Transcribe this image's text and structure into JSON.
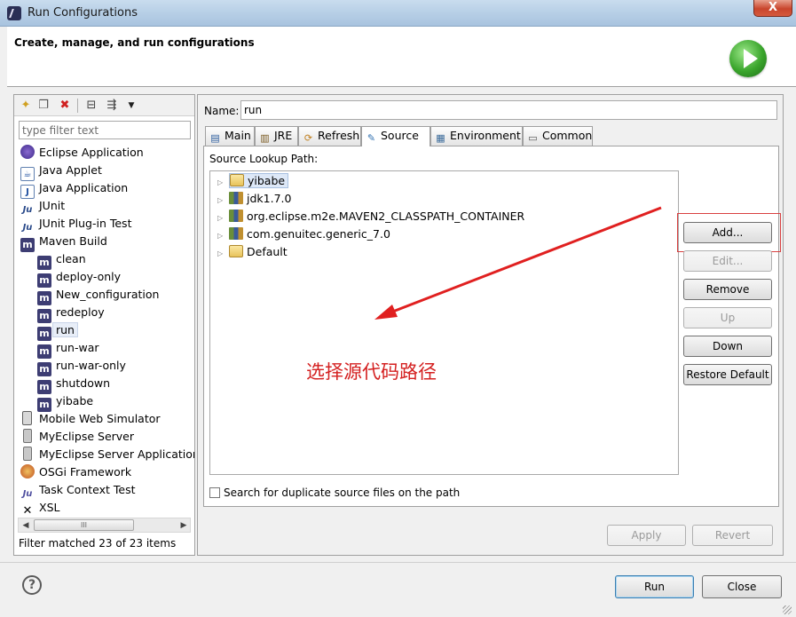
{
  "window": {
    "title": "Run Configurations",
    "close_glyph": "X"
  },
  "banner": {
    "title": "Create, manage, and run configurations",
    "icon": "run-icon"
  },
  "left": {
    "toolbar": {
      "new_icon": "new-config-icon",
      "duplicate_icon": "duplicate-icon",
      "delete_icon": "delete-icon",
      "collapse_icon": "collapse-all-icon",
      "filter_icon": "filter-icon"
    },
    "filter_placeholder": "type filter text",
    "tree": [
      {
        "label": "Eclipse Application",
        "icon": "eclipse-icon",
        "glyph": ""
      },
      {
        "label": "Java Applet",
        "icon": "java-applet-icon",
        "glyph": "☕"
      },
      {
        "label": "Java Application",
        "icon": "java-app-icon",
        "glyph": "J"
      },
      {
        "label": "JUnit",
        "icon": "junit-icon",
        "glyph": "Ju"
      },
      {
        "label": "JUnit Plug-in Test",
        "icon": "junit-plugin-icon",
        "glyph": "Ju"
      },
      {
        "label": "Maven Build",
        "icon": "maven-icon",
        "glyph": "m"
      },
      {
        "label": "clean",
        "icon": "maven-icon",
        "glyph": "m"
      },
      {
        "label": "deploy-only",
        "icon": "maven-icon",
        "glyph": "m"
      },
      {
        "label": "New_configuration",
        "icon": "maven-icon",
        "glyph": "m"
      },
      {
        "label": "redeploy",
        "icon": "maven-icon",
        "glyph": "m"
      },
      {
        "label": "run",
        "icon": "maven-icon",
        "glyph": "m"
      },
      {
        "label": "run-war",
        "icon": "maven-icon",
        "glyph": "m"
      },
      {
        "label": "run-war-only",
        "icon": "maven-icon",
        "glyph": "m"
      },
      {
        "label": "shutdown",
        "icon": "maven-icon",
        "glyph": "m"
      },
      {
        "label": "yibabe",
        "icon": "maven-icon",
        "glyph": "m"
      },
      {
        "label": "Mobile Web Simulator",
        "icon": "mobile-icon",
        "glyph": ""
      },
      {
        "label": "MyEclipse Server",
        "icon": "server-icon",
        "glyph": ""
      },
      {
        "label": "MyEclipse Server Application",
        "icon": "server-app-icon",
        "glyph": ""
      },
      {
        "label": "OSGi Framework",
        "icon": "osgi-icon",
        "glyph": ""
      },
      {
        "label": "Task Context Test",
        "icon": "task-context-icon",
        "glyph": "Ju"
      },
      {
        "label": "XSL",
        "icon": "xsl-icon",
        "glyph": "✕"
      }
    ],
    "scroll_thumb": "III",
    "filter_status": "Filter matched 23 of 23 items"
  },
  "right": {
    "name_label": "Name:",
    "name_value": "run",
    "tabs": [
      {
        "label": "Main",
        "icon": "main-tab-icon",
        "glyph": "▤"
      },
      {
        "label": "JRE",
        "icon": "jre-tab-icon",
        "glyph": "▥"
      },
      {
        "label": "Refresh",
        "icon": "refresh-tab-icon",
        "glyph": "⟳"
      },
      {
        "label": "Source",
        "icon": "source-tab-icon",
        "glyph": "✎"
      },
      {
        "label": "Environment",
        "icon": "environment-tab-icon",
        "glyph": "▦"
      },
      {
        "label": "Common",
        "icon": "common-tab-icon",
        "glyph": "▭"
      }
    ],
    "source_lookup_label": "Source Lookup Path:",
    "source_items": [
      {
        "label": "yibabe",
        "icon": "project-folder-icon"
      },
      {
        "label": "jdk1.7.0",
        "icon": "library-icon"
      },
      {
        "label": "org.eclipse.m2e.MAVEN2_CLASSPATH_CONTAINER",
        "icon": "library-icon"
      },
      {
        "label": "com.genuitec.generic_7.0",
        "icon": "library-icon"
      },
      {
        "label": "Default",
        "icon": "folder-icon"
      }
    ],
    "buttons": {
      "add": "Add...",
      "edit": "Edit...",
      "remove": "Remove",
      "up": "Up",
      "down": "Down",
      "restore": "Restore Default"
    },
    "duplicate_checkbox": "Search for duplicate source files on the path",
    "apply": "Apply",
    "revert": "Revert"
  },
  "annotation": {
    "text": "选择源代码路径",
    "color": "#d42020"
  },
  "footer": {
    "help_glyph": "?",
    "run": "Run",
    "close": "Close"
  }
}
